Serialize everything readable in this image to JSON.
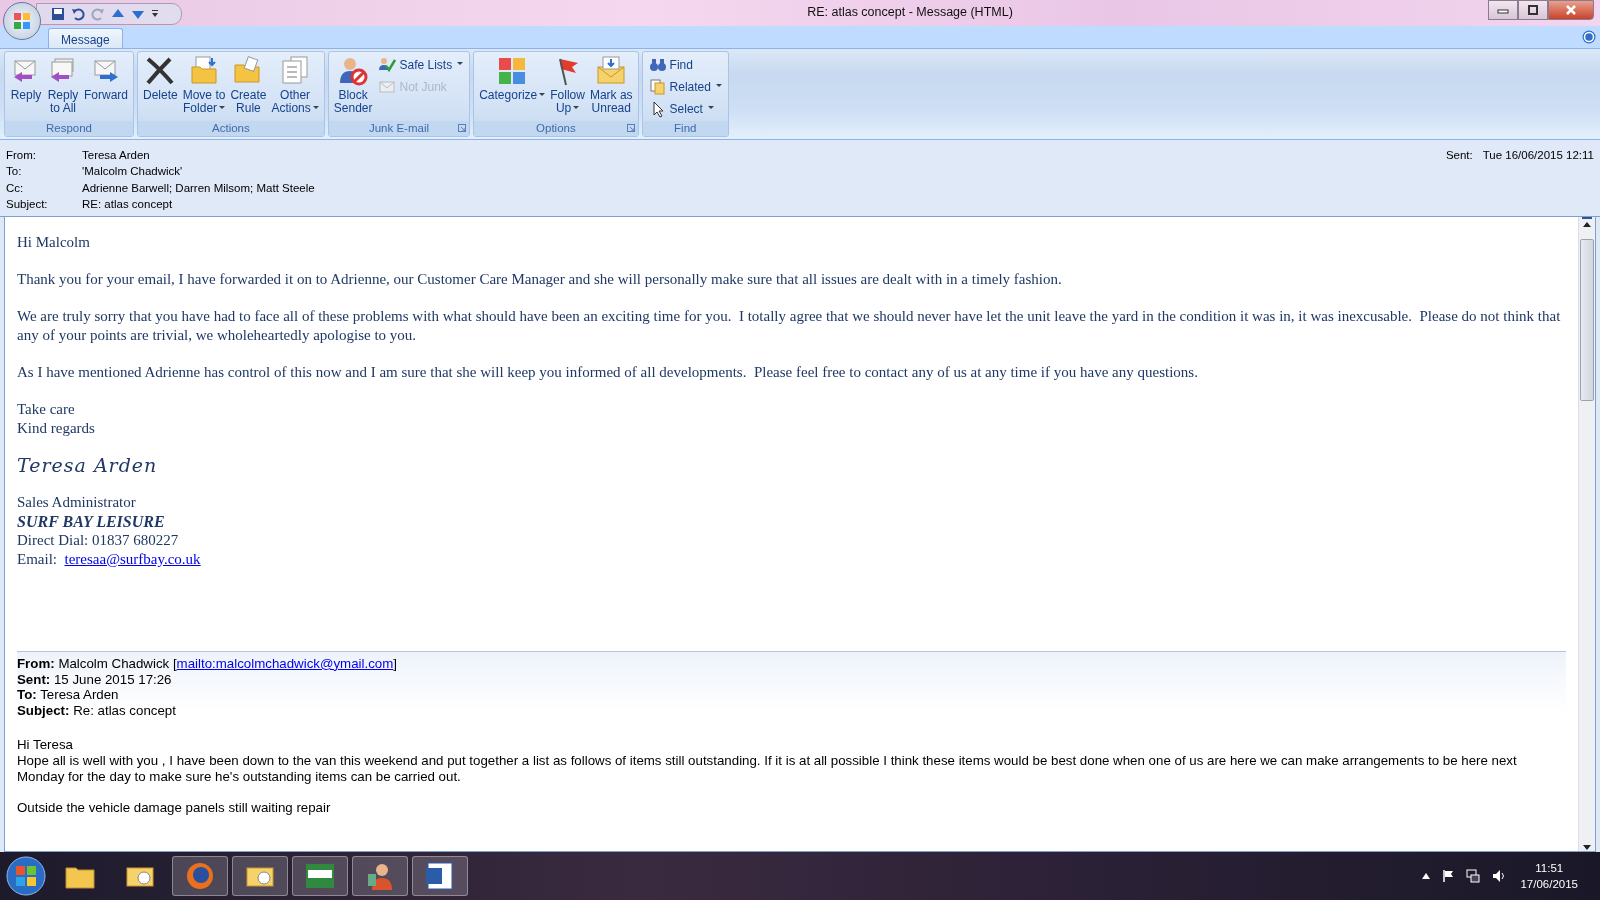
{
  "window": {
    "title": "RE:  atlas concept  - Message (HTML)"
  },
  "tabs": [
    {
      "label": "Message",
      "selected": true
    }
  ],
  "ribbon_groups": [
    {
      "label": "Respond",
      "launcher": false,
      "buttons": [
        {
          "kind": "large",
          "label": "Reply",
          "dropdown": false,
          "disabled": false
        },
        {
          "kind": "large",
          "label": "Reply\nto All",
          "dropdown": false,
          "disabled": false
        },
        {
          "kind": "large",
          "label": "Forward",
          "dropdown": false,
          "disabled": false
        }
      ]
    },
    {
      "label": "Actions",
      "launcher": false,
      "buttons": [
        {
          "kind": "large",
          "label": "Delete",
          "dropdown": false,
          "disabled": false
        },
        {
          "kind": "large",
          "label": "Move to\nFolder",
          "dropdown": true,
          "disabled": false
        },
        {
          "kind": "large",
          "label": "Create\nRule",
          "dropdown": false,
          "disabled": false
        },
        {
          "kind": "large",
          "label": "Other\nActions",
          "dropdown": true,
          "disabled": false
        }
      ]
    },
    {
      "label": "Junk E-mail",
      "launcher": true,
      "buttons": [
        {
          "kind": "large",
          "label": "Block\nSender",
          "dropdown": false,
          "disabled": false
        },
        {
          "kind": "small",
          "label": "Safe Lists",
          "dropdown": true,
          "disabled": false
        },
        {
          "kind": "small",
          "label": "Not Junk",
          "dropdown": false,
          "disabled": true
        }
      ]
    },
    {
      "label": "Options",
      "launcher": true,
      "buttons": [
        {
          "kind": "large",
          "label": "Categorize",
          "dropdown": true,
          "disabled": false
        },
        {
          "kind": "large",
          "label": "Follow\nUp",
          "dropdown": true,
          "disabled": false
        },
        {
          "kind": "large",
          "label": "Mark as\nUnread",
          "dropdown": false,
          "disabled": false
        }
      ]
    },
    {
      "label": "Find",
      "launcher": false,
      "buttons": [
        {
          "kind": "small",
          "label": "Find",
          "dropdown": false,
          "disabled": false
        },
        {
          "kind": "small",
          "label": "Related",
          "dropdown": true,
          "disabled": false
        },
        {
          "kind": "small",
          "label": "Select",
          "dropdown": true,
          "disabled": false
        }
      ]
    }
  ],
  "headers": [
    {
      "label": "From:",
      "value": "Teresa Arden"
    },
    {
      "label": "To:",
      "value": "'Malcolm Chadwick'"
    },
    {
      "label": "Cc:",
      "value": "Adrienne Barwell; Darren Milsom; Matt Steele"
    },
    {
      "label": "Subject:",
      "value": "RE:  atlas concept"
    }
  ],
  "sent": {
    "label": "Sent:",
    "value": "Tue 16/06/2015 12:11"
  },
  "message": {
    "greeting": "Hi Malcolm",
    "paragraphs": [
      "Thank you for your email, I have forwarded it on to Adrienne, our Customer Care Manager and she will personally make sure that all issues are dealt with in a timely fashion.",
      "We are truly sorry that you have had to face all of these problems with what should have been an exciting time for you.  I totally agree that we should never have let the unit leave the yard in the condition it was in, it was inexcusable.  Please do not think that any of your points are trivial, we wholeheartedly apologise to you.",
      "As I have mentioned Adrienne has control of this now and I am sure that she will keep you informed of all developments.  Please feel free to contact any of us at any time if you have any questions."
    ],
    "closing": [
      "Take care",
      "Kind regards"
    ],
    "signature_name": "Teresa Arden",
    "job_title": "Sales Administrator",
    "company": "SURF BAY LEISURE",
    "direct_dial": "Direct Dial:  01837 680227",
    "email_label": "Email:",
    "email": "teresaa@surfbay.co.uk"
  },
  "quoted": {
    "fields": [
      {
        "label": "From:",
        "value": "Malcolm Chadwick [",
        "link": "mailto:malcolmchadwick@ymail.com",
        "after": "]"
      },
      {
        "label": "Sent:",
        "value": "15 June 2015 17:26"
      },
      {
        "label": "To:",
        "value": "Teresa Arden"
      },
      {
        "label": "Subject:",
        "value": "Re: atlas concept"
      }
    ],
    "paragraphs": [
      [
        "Hi Teresa",
        "Hope all is well with you , I have been down to the van this weekend and put together a list as follows of items still outstanding. If it is at all possible I think these items would be best done when one of us are here we can make arrangements to be here next Monday for the day to make sure he's outstanding items can be carried out."
      ],
      [
        "Outside the vehicle damage panels still waiting repair"
      ]
    ]
  },
  "taskbar": {
    "time": "11:51",
    "date": "17/06/2015"
  }
}
